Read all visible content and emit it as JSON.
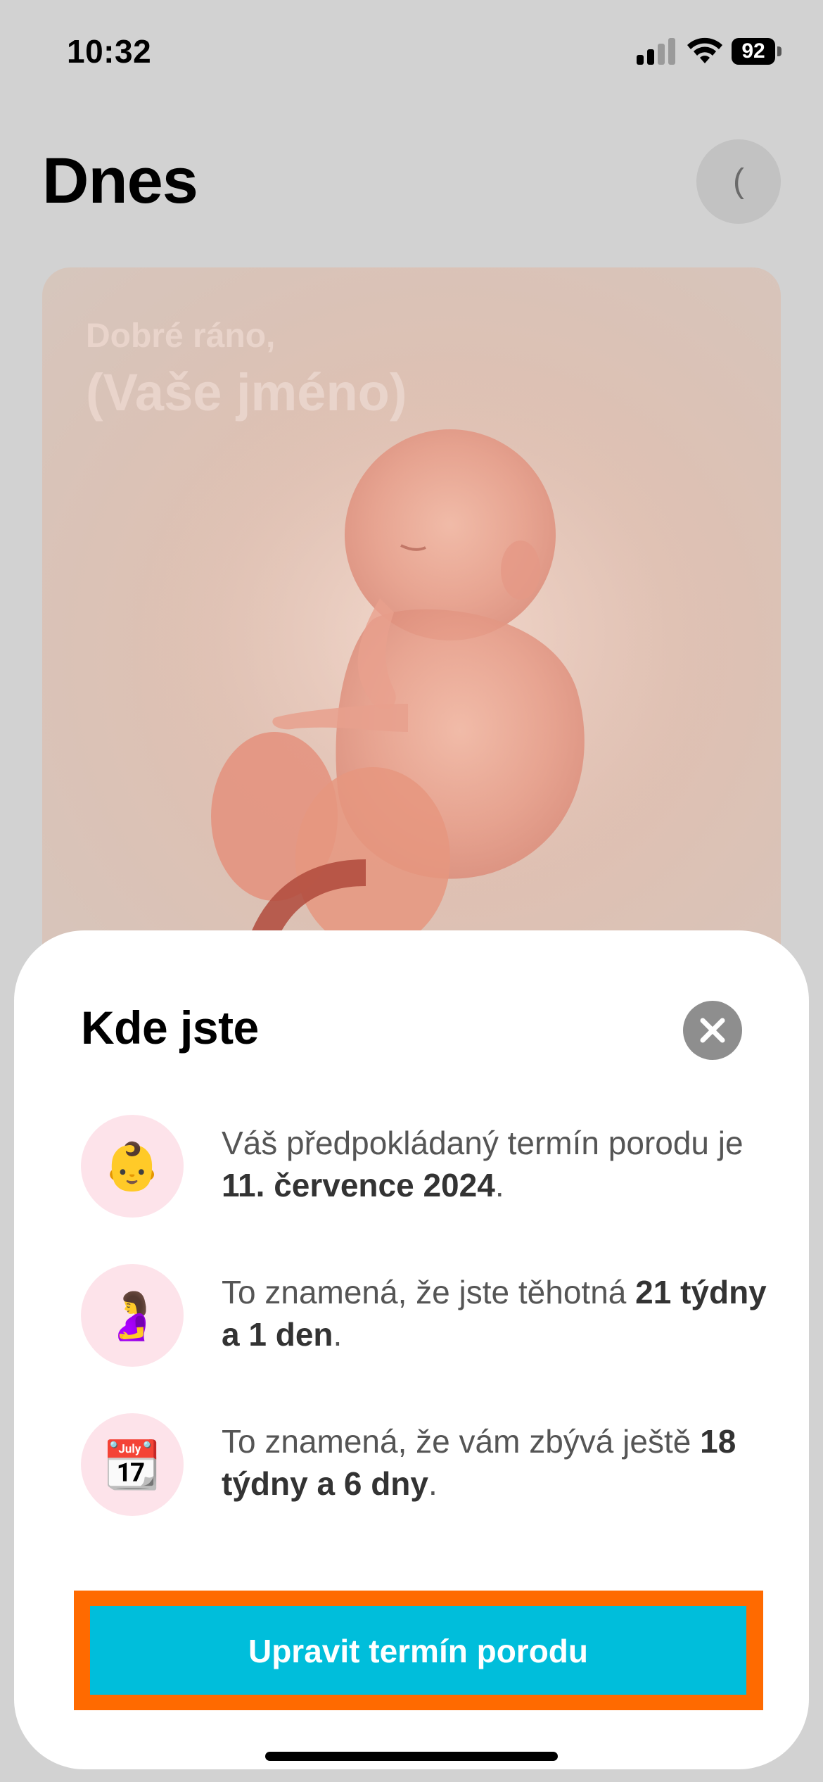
{
  "status_bar": {
    "time": "10:32",
    "battery": "92"
  },
  "header": {
    "title": "Dnes",
    "avatar_text": "("
  },
  "hero": {
    "greeting": "Dobré ráno,",
    "name": "(Vaše jméno)"
  },
  "sheet": {
    "title": "Kde jste",
    "rows": [
      {
        "icon": "baby-emoji",
        "emoji": "👶",
        "text_pre": "Váš předpokládaný termín porodu je ",
        "text_bold": "11. července 2024",
        "text_post": "."
      },
      {
        "icon": "pregnant-woman-emoji",
        "emoji": "🤰",
        "text_pre": "To znamená, že jste těhotná ",
        "text_bold": "21 týdny a 1 den",
        "text_post": "."
      },
      {
        "icon": "calendar-emoji",
        "emoji": "📆",
        "text_pre": "To znamená, že vám zbývá ještě ",
        "text_bold": "18 týdny a 6 dny",
        "text_post": "."
      }
    ],
    "button_label": "Upravit termín porodu"
  },
  "colors": {
    "accent": "#00bedb",
    "highlight": "#ff6a00",
    "icon_bg": "#fde3ea"
  }
}
